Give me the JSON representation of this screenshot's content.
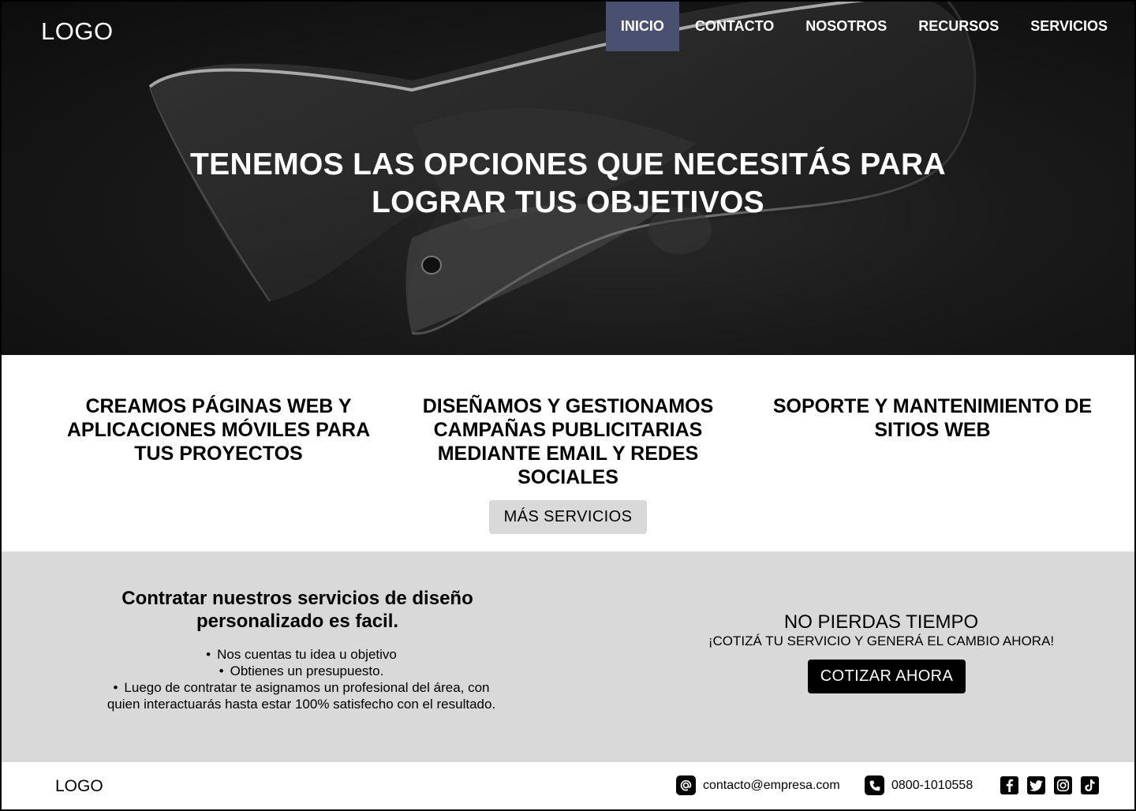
{
  "header": {
    "logo": "LOGO",
    "nav": [
      {
        "label": "INICIO",
        "active": true
      },
      {
        "label": "CONTACTO",
        "active": false
      },
      {
        "label": "NOSOTROS",
        "active": false
      },
      {
        "label": "RECURSOS",
        "active": false
      },
      {
        "label": "SERVICIOS",
        "active": false
      }
    ],
    "active_color": "#4a5070"
  },
  "hero": {
    "title_line1": "TENEMOS LAS OPCIONES QUE NECESITÁS PARA",
    "title_line2": "LOGRAR TUS OBJETIVOS"
  },
  "services": {
    "items": [
      "CREAMOS PÁGINAS WEB Y APLICACIONES MÓVILES PARA TUS PROYECTOS",
      "DISEÑAMOS Y GESTIONAMOS CAMPAÑAS PUBLICITARIAS MEDIANTE EMAIL Y REDES SOCIALES",
      "SOPORTE Y MANTENIMIENTO DE SITIOS WEB"
    ],
    "more_button": "MÁS SERVICIOS"
  },
  "process": {
    "title": "Contratar nuestros servicios de diseño personalizado es facil.",
    "steps": [
      "Nos cuentas tu idea u objetivo",
      "Obtienes un presupuesto.",
      "Luego de contratar te asignamos un profesional del área, con quien interactuarás hasta estar 100% satisfecho con el resultado."
    ]
  },
  "cta": {
    "title": "NO PIERDAS TIEMPO",
    "subtitle": "¡COTIZÁ TU SERVICIO Y GENERÁ EL CAMBIO AHORA!",
    "button": "COTIZAR AHORA"
  },
  "footer": {
    "logo": "LOGO",
    "email": "contacto@empresa.com",
    "phone": "0800-1010558",
    "socials": [
      "facebook-icon",
      "twitter-icon",
      "instagram-icon",
      "tiktok-icon"
    ]
  }
}
